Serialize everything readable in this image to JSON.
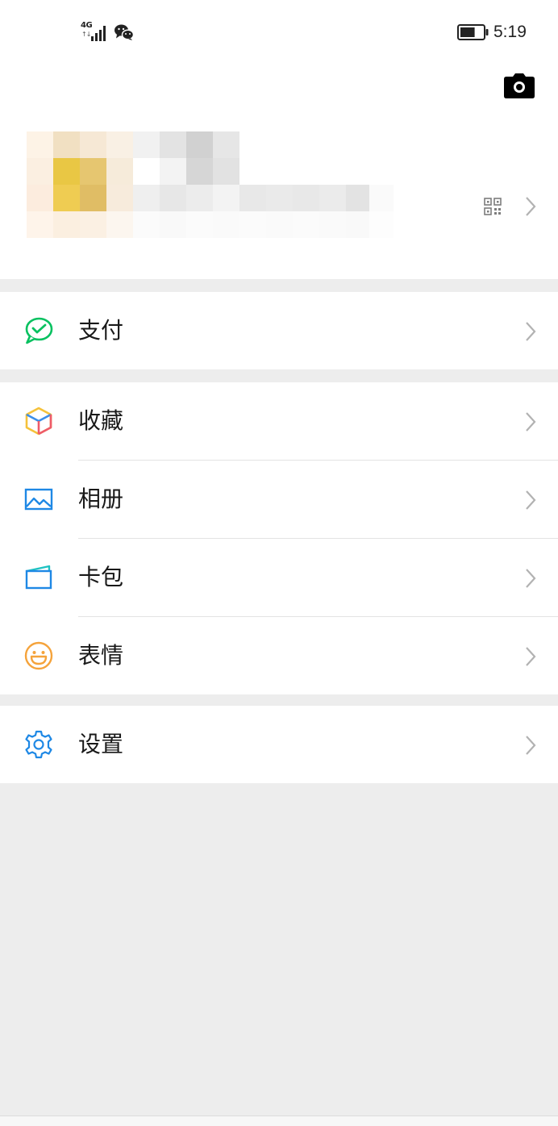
{
  "status_bar": {
    "network_type": "4G",
    "network_arrows": "↑↓",
    "time": "5:19",
    "icons": [
      "signal-icon",
      "wechat-icon",
      "battery-icon"
    ],
    "battery_level": 0.65
  },
  "profile": {
    "name": "",
    "wechat_id": "",
    "camera_icon": "camera-icon",
    "qr_icon": "qr-code-icon",
    "avatar_blurred": true
  },
  "menu": {
    "pay": {
      "label": "支付",
      "icon": "wechat-pay-icon",
      "color": "#07c160"
    },
    "favorites": {
      "label": "收藏",
      "icon": "favorites-cube-icon"
    },
    "album": {
      "label": "相册",
      "icon": "album-icon",
      "color": "#1e88e5"
    },
    "cards": {
      "label": "卡包",
      "icon": "card-wallet-icon",
      "color": "#1e88e5"
    },
    "stickers": {
      "label": "表情",
      "icon": "sticker-smile-icon",
      "color": "#f5a33b"
    },
    "settings": {
      "label": "设置",
      "icon": "settings-gear-icon",
      "color": "#1e88e5"
    }
  },
  "colors": {
    "background": "#ededed",
    "surface": "#ffffff",
    "text": "#191919",
    "chevron": "#b2b2b2"
  }
}
